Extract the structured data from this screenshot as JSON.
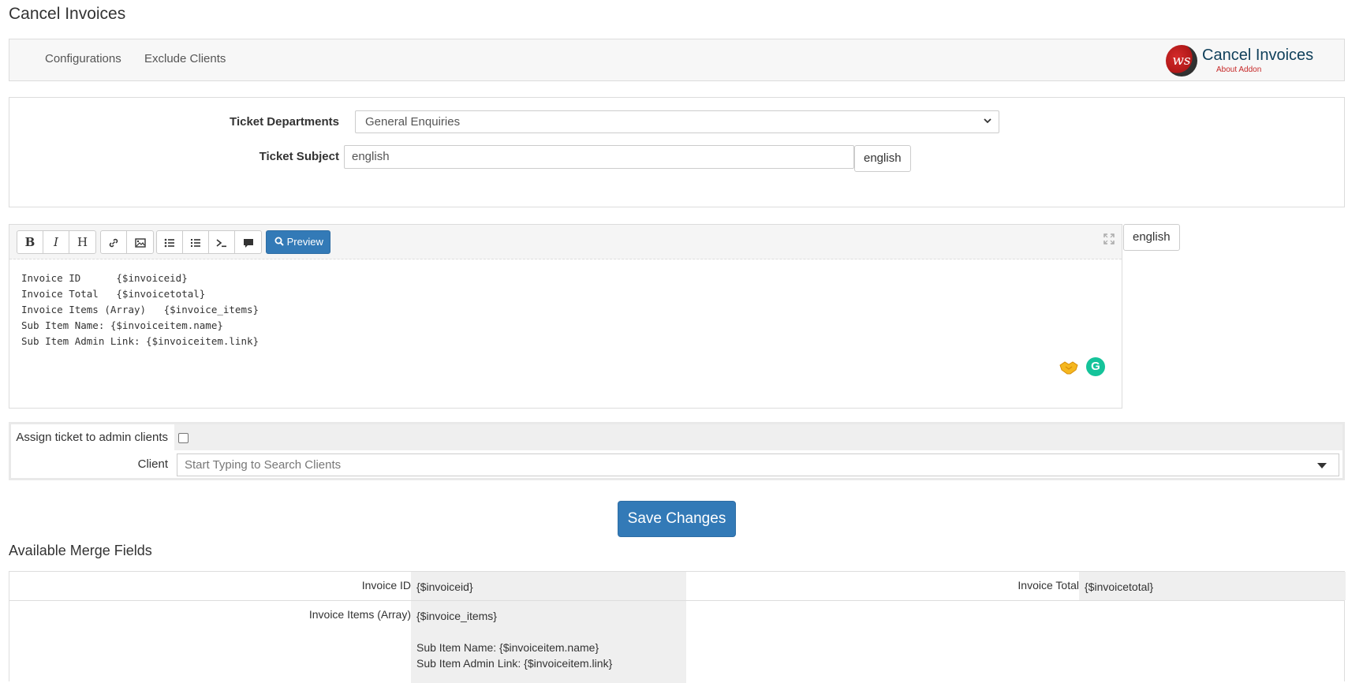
{
  "page_title": "Cancel Invoices",
  "nav": {
    "items": [
      "Configurations",
      "Exclude Clients"
    ],
    "brand_title": "Cancel Invoices",
    "brand_sub": "About Addon",
    "brand_logo_text": "ws"
  },
  "config": {
    "department_label": "Ticket Departments",
    "department_value": "General Enquiries",
    "subject_label": "Ticket Subject",
    "subject_value": "english",
    "subject_lang_button": "english"
  },
  "editor": {
    "toolbar": {
      "bold": "B",
      "italic": "I",
      "heading": "H",
      "preview": "Preview"
    },
    "lang_button": "english",
    "content": "Invoice ID      {$invoiceid}\nInvoice Total   {$invoicetotal}\nInvoice Items (Array)   {$invoice_items}\nSub Item Name: {$invoiceitem.name}\nSub Item Admin Link: {$invoiceitem.link}",
    "grammarly_letter": "G"
  },
  "assign": {
    "admin_clients_label": "Assign ticket to admin clients",
    "admin_clients_checked": false,
    "client_label": "Client",
    "client_placeholder": "Start Typing to Search Clients"
  },
  "save_label": "Save Changes",
  "merge": {
    "title": "Available Merge Fields",
    "fields": [
      {
        "label": "Invoice ID",
        "value": "{$invoiceid}"
      },
      {
        "label": "Invoice Total",
        "value": "{$invoicetotal}"
      },
      {
        "label": "Invoice Items (Array)",
        "value": "{$invoice_items}"
      }
    ],
    "sub_items": [
      "Sub Item Name: {$invoiceitem.name}",
      "Sub Item Admin Link: {$invoiceitem.link}"
    ]
  },
  "colors": {
    "primary": "#337ab7",
    "grammarly": "#15c39a",
    "brand_red": "#c62828"
  }
}
